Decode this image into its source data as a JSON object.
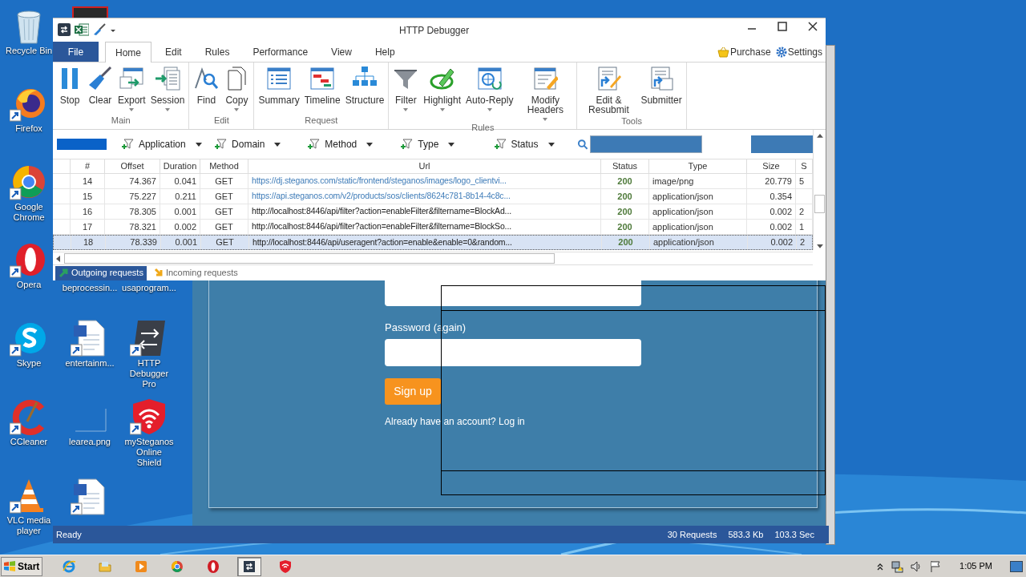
{
  "window": {
    "title": "HTTP Debugger"
  },
  "ribbon_tabs": [
    {
      "label": "File",
      "kind": "file"
    },
    {
      "label": "Home",
      "kind": "tab",
      "selected": true
    },
    {
      "label": "Edit",
      "kind": "tab",
      "selected": false
    },
    {
      "label": "Rules",
      "kind": "tab",
      "selected": false
    },
    {
      "label": "Performance",
      "kind": "tab",
      "selected": false
    },
    {
      "label": "View",
      "kind": "tab",
      "selected": false
    },
    {
      "label": "Help",
      "kind": "tab",
      "selected": false
    }
  ],
  "top_links": [
    {
      "label": "Purchase",
      "kind": "basket"
    },
    {
      "label": "Settings",
      "kind": "gear"
    }
  ],
  "ribbon_groups": [
    {
      "label": "Main",
      "buttons": [
        {
          "label": "Stop",
          "kind": "pause",
          "dropdown": false
        },
        {
          "label": "Clear",
          "kind": "brush",
          "dropdown": false
        },
        {
          "label": "Export",
          "kind": "export",
          "dropdown": true
        },
        {
          "label": "Session",
          "kind": "session",
          "dropdown": true
        }
      ]
    },
    {
      "label": "Edit",
      "buttons": [
        {
          "label": "Find",
          "kind": "find",
          "dropdown": false
        },
        {
          "label": "Copy",
          "kind": "copy",
          "dropdown": true
        }
      ]
    },
    {
      "label": "Request",
      "buttons": [
        {
          "label": "Summary",
          "kind": "summary",
          "dropdown": false
        },
        {
          "label": "Timeline",
          "kind": "timeline",
          "dropdown": false
        },
        {
          "label": "Structure",
          "kind": "structure",
          "dropdown": false
        }
      ]
    },
    {
      "label": "Rules",
      "buttons": [
        {
          "label": "Filter",
          "kind": "filter",
          "dropdown": true
        },
        {
          "label": "Highlight",
          "kind": "highlight",
          "dropdown": true
        },
        {
          "label": "Auto-Reply",
          "kind": "autoreply",
          "dropdown": true
        },
        {
          "label": "Modify Headers",
          "kind": "modify",
          "dropdown": true
        }
      ]
    },
    {
      "label": "Tools",
      "buttons": [
        {
          "label": "Edit & Resubmit",
          "kind": "editresubmit",
          "dropdown": false
        },
        {
          "label": "Submitter",
          "kind": "submitter",
          "dropdown": false
        }
      ]
    }
  ],
  "filters": [
    {
      "label": "Application"
    },
    {
      "label": "Domain"
    },
    {
      "label": "Method"
    },
    {
      "label": "Type"
    },
    {
      "label": "Status"
    }
  ],
  "table": {
    "columns": [
      "#",
      "Offset",
      "Duration",
      "Method",
      "Url",
      "Status",
      "Type",
      "Size",
      "S"
    ],
    "rows": [
      {
        "selected": false,
        "color": "#3f7cb8",
        "cells": [
          "14",
          "74.367",
          "0.041",
          "GET",
          "https://dj.steganos.com/static/frontend/steganos/images/logo_clientvi...",
          "200",
          "image/png",
          "20.779",
          "5"
        ]
      },
      {
        "selected": false,
        "color": "#3f7cb8",
        "cells": [
          "15",
          "75.227",
          "0.211",
          "GET",
          "https://api.steganos.com/v2/products/sos/clients/8624c781-8b14-4c8c...",
          "200",
          "application/json",
          "0.354"
        ]
      },
      {
        "selected": false,
        "color": "#202020",
        "cells": [
          "16",
          "78.305",
          "0.001",
          "GET",
          "http://localhost:8446/api/filter?action=enableFilter&filtername=BlockAd...",
          "200",
          "application/json",
          "0.002",
          "2"
        ]
      },
      {
        "selected": false,
        "color": "#202020",
        "cells": [
          "17",
          "78.321",
          "0.002",
          "GET",
          "http://localhost:8446/api/filter?action=enableFilter&filtername=BlockSo...",
          "200",
          "application/json",
          "0.002",
          "1"
        ]
      },
      {
        "selected": true,
        "color": "#202020",
        "cells": [
          "18",
          "78.339",
          "0.001",
          "GET",
          "http://localhost:8446/api/useragent?action=enable&enable=0&random...",
          "200",
          "application/json",
          "0.002",
          "2"
        ]
      }
    ]
  },
  "bottom_tabs": [
    {
      "label": "Outgoing requests",
      "selected": true
    },
    {
      "label": "Incoming requests",
      "selected": false
    }
  ],
  "status_bar": {
    "state": "Ready",
    "items": [
      "30 Requests",
      "583.3 Kb",
      "103.3 Sec"
    ]
  },
  "browser_page": {
    "field_label": "Password (again)",
    "button": "Sign up",
    "footer": "Already have an account? Log in"
  },
  "desktop_icons": [
    {
      "label": "Recycle Bin",
      "kind": "recycle"
    },
    {
      "label": "Firefox",
      "kind": "firefox"
    },
    {
      "label": "Google Chrome",
      "kind": "chrome"
    },
    {
      "label": "Opera",
      "kind": "opera"
    },
    {
      "label": "Skype",
      "kind": "skype"
    },
    {
      "label": "CCleaner",
      "kind": "ccleaner"
    },
    {
      "label": "VLC media player",
      "kind": "vlc"
    },
    {
      "label": "beprocessin..."
    },
    {
      "label": "usaprogram..."
    },
    {
      "label": "entertainm...",
      "kind": "word"
    },
    {
      "label": "HTTP Debugger Pro",
      "kind": "debugger"
    },
    {
      "label": "learea.png",
      "kind": "image"
    },
    {
      "label": "mySteganos Online Shield",
      "kind": "shield"
    },
    {
      "kind": "word"
    }
  ],
  "taskbar": {
    "start": "Start",
    "apps": [
      {
        "kind": "ie",
        "selected": false
      },
      {
        "kind": "folder",
        "selected": false
      },
      {
        "kind": "media",
        "selected": false
      },
      {
        "kind": "chrome",
        "selected": false
      },
      {
        "kind": "opera",
        "selected": false
      },
      {
        "kind": "debugger",
        "selected": true
      },
      {
        "kind": "shield",
        "selected": false
      }
    ],
    "clock": "1:05 PM"
  }
}
